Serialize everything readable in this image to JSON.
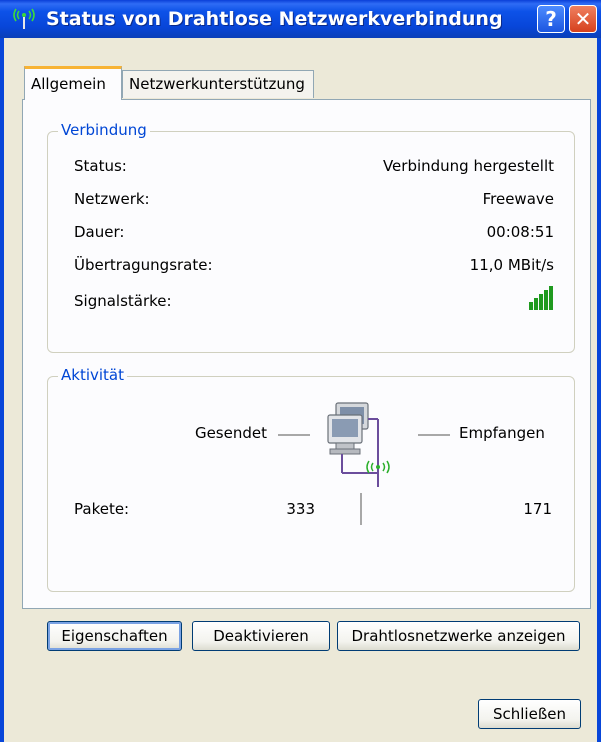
{
  "window": {
    "title": "Status von Drahtlose Netzwerkverbindung",
    "help_label": "?",
    "close_label": "✕"
  },
  "tabs": [
    {
      "label": "Allgemein",
      "active": true
    },
    {
      "label": "Netzwerkunterstützung",
      "active": false
    }
  ],
  "connection": {
    "legend": "Verbindung",
    "rows": [
      {
        "label": "Status:",
        "value": "Verbindung hergestellt"
      },
      {
        "label": "Netzwerk:",
        "value": "Freewave"
      },
      {
        "label": "Dauer:",
        "value": "00:08:51"
      },
      {
        "label": "Übertragungsrate:",
        "value": "11,0 MBit/s"
      }
    ],
    "signal_label": "Signalstärke:",
    "signal_level": 5,
    "signal_max": 5,
    "signal_color": "#1f9a1f"
  },
  "activity": {
    "legend": "Aktivität",
    "sent_label": "Gesendet",
    "received_label": "Empfangen",
    "packets_label": "Pakete:",
    "packets_sent": "333",
    "packets_received": "171"
  },
  "buttons": {
    "properties": "Eigenschaften",
    "disable": "Deaktivieren",
    "show_networks": "Drahtlosnetzwerke anzeigen",
    "close": "Schließen"
  },
  "colors": {
    "titlebar": "#0a4fe0",
    "legend": "#0046d5",
    "tab_highlight": "#f7b335"
  }
}
